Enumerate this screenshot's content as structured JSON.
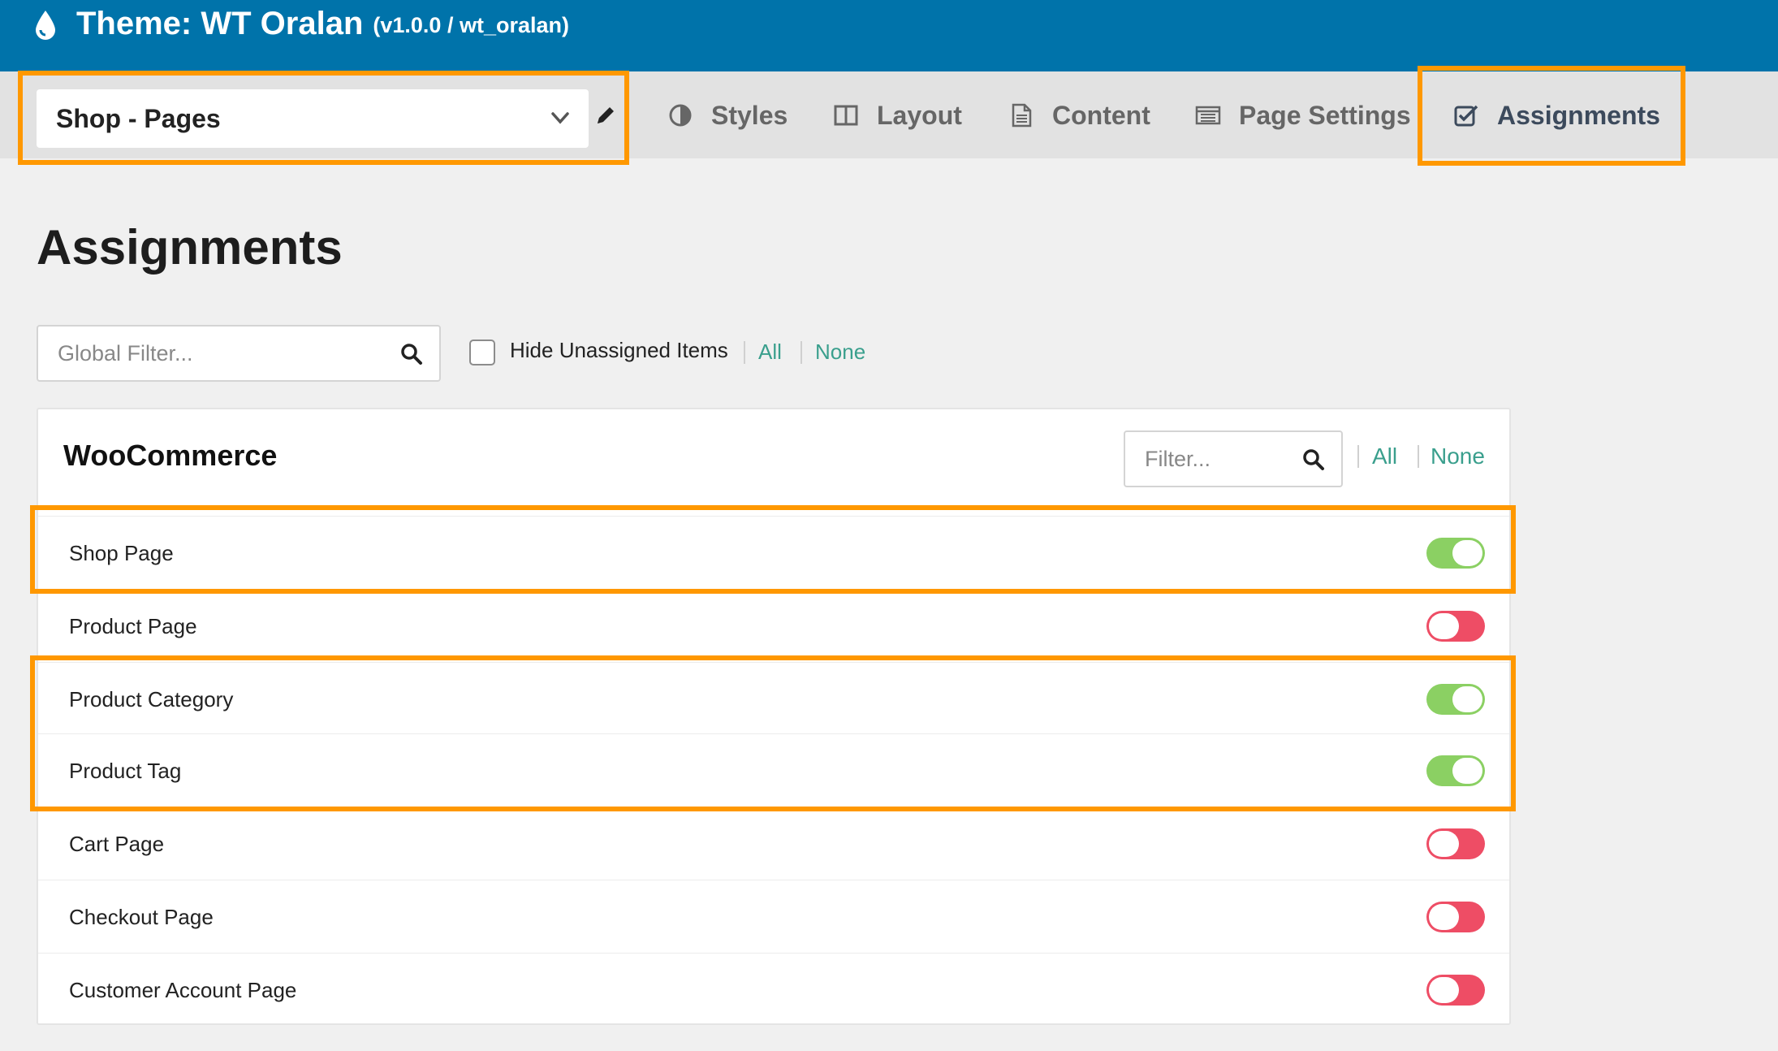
{
  "header": {
    "title": "Theme: WT Oralan",
    "subtitle": "(v1.0.0 / wt_oralan)"
  },
  "layout_selector": {
    "value": "Shop - Pages"
  },
  "tabs": [
    {
      "label": "Styles",
      "icon": "half-circle-icon"
    },
    {
      "label": "Layout",
      "icon": "columns-icon"
    },
    {
      "label": "Content",
      "icon": "document-icon"
    },
    {
      "label": "Page Settings",
      "icon": "list-window-icon"
    },
    {
      "label": "Assignments",
      "icon": "checkbox-icon",
      "active": true
    }
  ],
  "page": {
    "title": "Assignments"
  },
  "global_filter": {
    "placeholder": "Global Filter...",
    "hide_unassigned_label": "Hide Unassigned Items",
    "all_label": "All",
    "none_label": "None"
  },
  "panel": {
    "title": "WooCommerce",
    "filter_placeholder": "Filter...",
    "all_label": "All",
    "none_label": "None",
    "items": [
      {
        "label": "Shop Page",
        "on": true
      },
      {
        "label": "Product Page",
        "on": false
      },
      {
        "label": "Product Category",
        "on": true
      },
      {
        "label": "Product Tag",
        "on": true
      },
      {
        "label": "Cart Page",
        "on": false
      },
      {
        "label": "Checkout Page",
        "on": false
      },
      {
        "label": "Customer Account Page",
        "on": false
      }
    ]
  },
  "colors": {
    "header_bg": "#0073aa",
    "highlight": "#ff9800",
    "toggle_on": "#8bd063",
    "toggle_off": "#ee4d65",
    "link": "#3a9f8d"
  }
}
